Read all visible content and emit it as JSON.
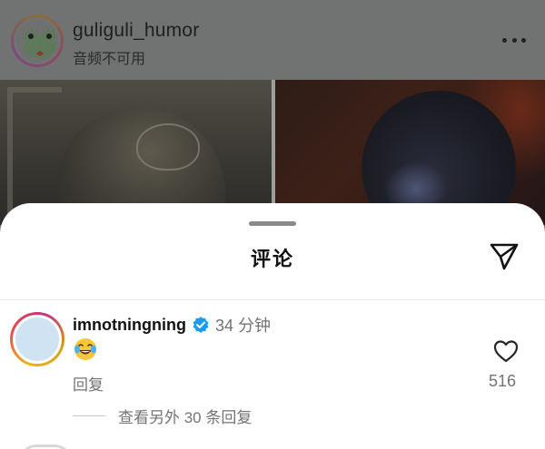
{
  "post": {
    "username": "guliguli_humor",
    "subtitle": "音频不可用",
    "avatar_icon": "frog-avatar-icon",
    "more_icon": "more-horizontal-icon"
  },
  "sheet": {
    "title": "评论",
    "share_icon": "send-icon"
  },
  "comment": {
    "username": "imnotningning",
    "verified_icon": "verified-badge-icon",
    "time": "34 分钟",
    "text_emoji": "face-with-tears-of-joy",
    "reply_label": "回复",
    "like_icon": "heart-outline-icon",
    "like_count": "516",
    "view_more_replies": "查看另外 30 条回复"
  },
  "colors": {
    "accent_verified": "#1d9bf0",
    "secondary_text": "#737373"
  }
}
